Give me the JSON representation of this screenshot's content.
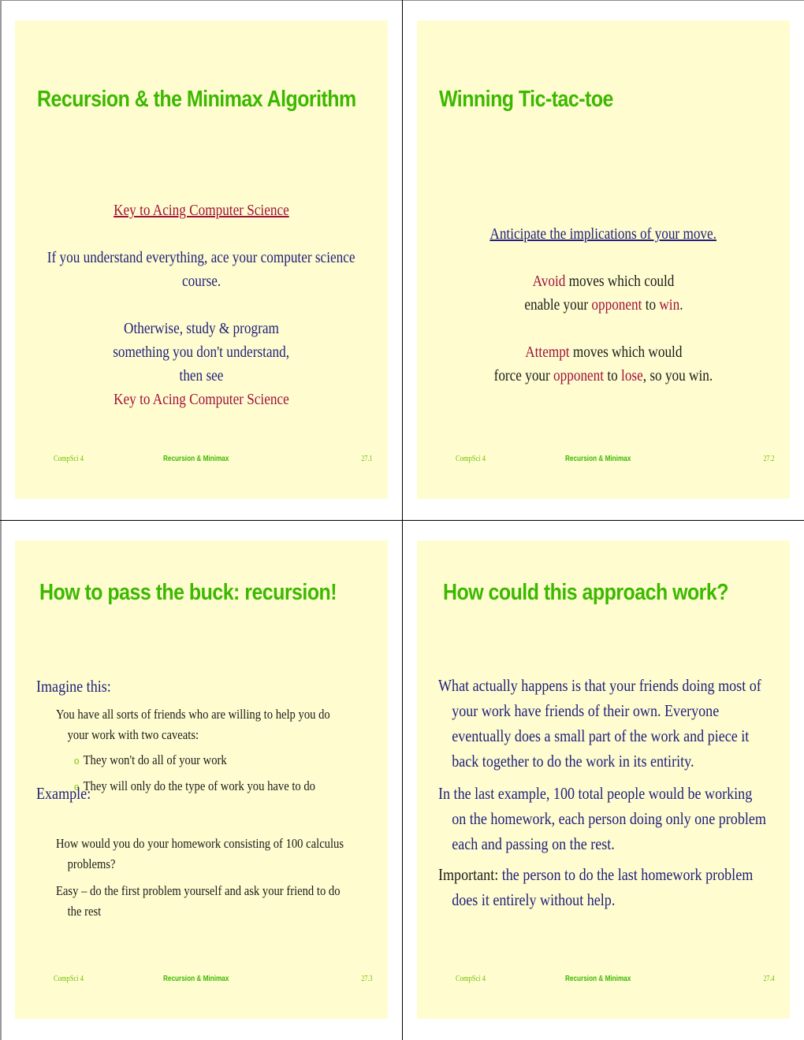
{
  "slides": [
    {
      "title": "Recursion & the Minimax Algorithm",
      "link_heading": "Key to Acing Computer Science",
      "para1_line1": "If you understand everything, ace your computer science",
      "para1_line2": "course.",
      "para2_line1": "Otherwise, study & program",
      "para2_line2": "something you don't understand,",
      "para2_line3": "then see",
      "para2_link": "Key to Acing Computer Science",
      "footer": {
        "left": "CompSci 4",
        "center": "Recursion & Minimax",
        "right": "27.1"
      }
    },
    {
      "title": "Winning Tic-tac-toe",
      "link_heading": "Anticipate the implications of your move.",
      "avoid": {
        "w1": "Avoid",
        "t1": " moves which could",
        "t2": "enable your ",
        "w2": "opponent",
        "t3": " to ",
        "w3": "win",
        "t4": "."
      },
      "attempt": {
        "w1": "Attempt",
        "t1": " moves which would",
        "t2": "force your ",
        "w2": "opponent",
        "t3": " to ",
        "w3": "lose",
        "t4": ", so you win."
      },
      "footer": {
        "left": "CompSci 4",
        "center": "Recursion & Minimax",
        "right": "27.2"
      }
    },
    {
      "title": "How to pass the buck: recursion!",
      "heading1": "Imagine this:",
      "item1_line1": "You have all sorts of friends who are willing to help you do",
      "item1_line2": "your work with two caveats:",
      "sub_bullet": "o",
      "sub1": "They won't do all of your work",
      "sub2": "They will only do the type of work you have to do",
      "heading2": "Example:",
      "item2_line1": "How would you do your homework consisting of 100 calculus",
      "item2_line2": "problems?",
      "item3_line1": "Easy – do the first problem yourself and ask your friend to do",
      "item3_line2": "the rest",
      "footer": {
        "left": "CompSci 4",
        "center": "Recursion & Minimax",
        "right": "27.3"
      }
    },
    {
      "title": "How could this approach work?",
      "p1": [
        "What actually happens is that your friends doing most of",
        "your work have friends of their own.  Everyone",
        "eventually does a small part of the work and piece it",
        "back together to do the work in its entirity."
      ],
      "p2": [
        "In the last example, 100 total people would be working",
        "on the homework, each person doing only one problem",
        "each and passing on the rest."
      ],
      "p3_label": "Important:",
      "p3": [
        " the person to do the last homework problem",
        "does it entirely without help."
      ],
      "footer": {
        "left": "CompSci 4",
        "center": "Recursion & Minimax",
        "right": "27.4"
      }
    }
  ]
}
